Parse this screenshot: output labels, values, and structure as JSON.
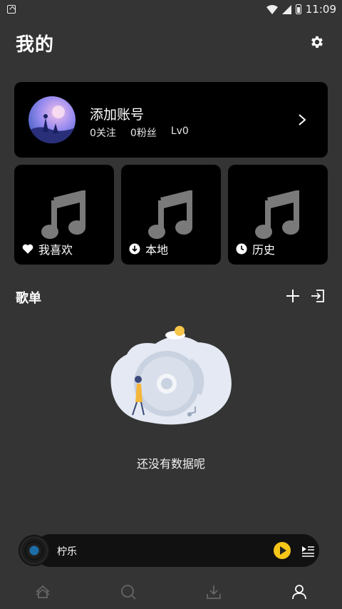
{
  "status_bar": {
    "time": "11:09"
  },
  "header": {
    "title": "我的"
  },
  "profile": {
    "name": "添加账号",
    "follow": "0关注",
    "fans": "0粉丝",
    "level": "Lv0"
  },
  "tiles": [
    {
      "label": "我喜欢",
      "icon": "heart-icon"
    },
    {
      "label": "本地",
      "icon": "download-circle-icon"
    },
    {
      "label": "历史",
      "icon": "clock-icon"
    }
  ],
  "playlist": {
    "title": "歌单",
    "empty_text": "还没有数据呢"
  },
  "player": {
    "song": "柠乐",
    "accent": "#f5c518"
  },
  "nav": [
    "home-icon",
    "search-icon",
    "download-icon",
    "profile-icon"
  ]
}
